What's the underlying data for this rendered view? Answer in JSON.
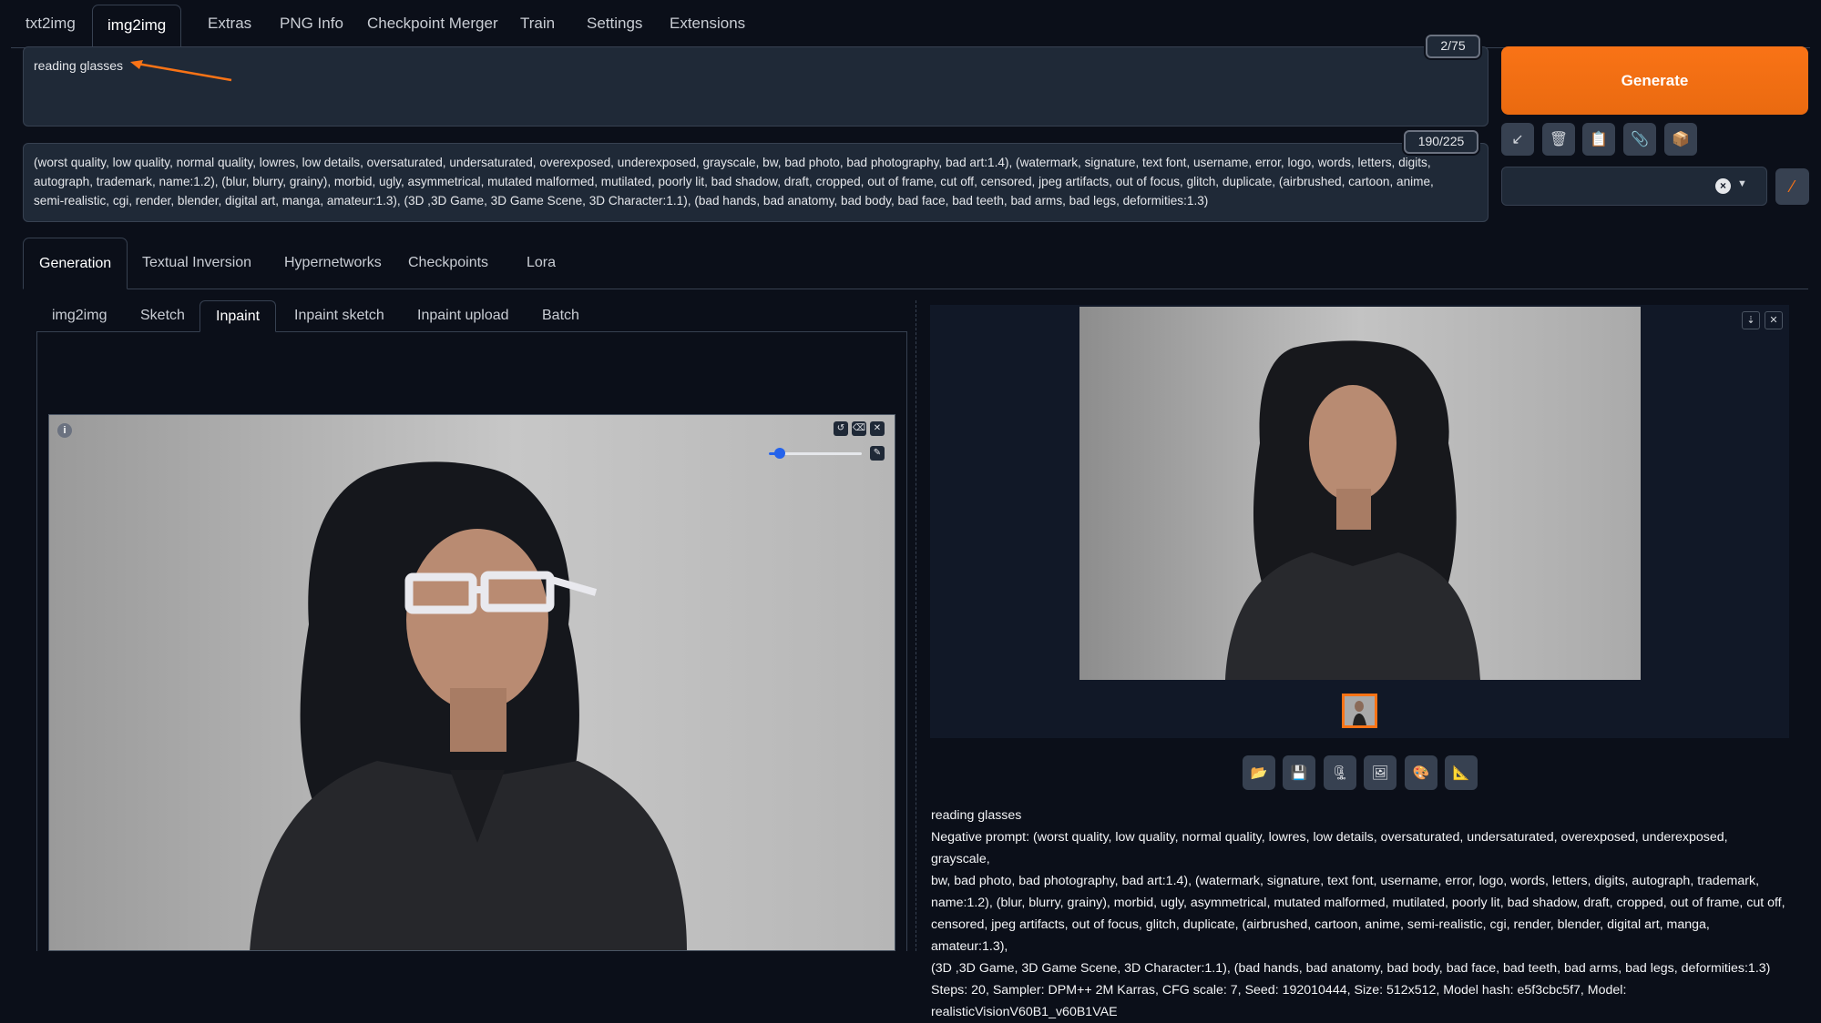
{
  "top_tabs": [
    "txt2img",
    "img2img",
    "Extras",
    "PNG Info",
    "Checkpoint Merger",
    "Train",
    "Settings",
    "Extensions"
  ],
  "prompt": {
    "value": "reading glasses",
    "token_count": "2/75"
  },
  "negative_prompt": {
    "token_count": "190/225",
    "lines": [
      "(worst quality, low quality, normal quality, lowres, low details, oversaturated, undersaturated, overexposed, underexposed, grayscale, bw, bad photo, bad photography, bad art:1.4), (watermark, signature, text font, username, error, logo, words, letters, digits,",
      "autograph, trademark, name:1.2), (blur, blurry, grainy), morbid, ugly, asymmetrical, mutated malformed, mutilated, poorly lit, bad shadow, draft, cropped, out of frame, cut off, censored, jpeg artifacts, out of focus, glitch, duplicate, (airbrushed, cartoon, anime,",
      "semi-realistic, cgi, render, blender, digital art, manga, amateur:1.3), (3D ,3D Game, 3D Game Scene, 3D Character:1.1), (bad hands, bad anatomy, bad body, bad face, bad teeth, bad arms, bad legs, deformities:1.3)"
    ]
  },
  "generate_label": "Generate",
  "tool_buttons": [
    {
      "icon": "arrow-down-left-icon",
      "glyph": "↙"
    },
    {
      "icon": "trash-icon",
      "glyph": "🗑"
    },
    {
      "icon": "clipboard-icon",
      "glyph": "📋"
    },
    {
      "icon": "paperclip-icon",
      "glyph": "📎"
    },
    {
      "icon": "package-icon",
      "glyph": "📦"
    }
  ],
  "section_tabs": [
    "Generation",
    "Textual Inversion",
    "Hypernetworks",
    "Checkpoints",
    "Lora"
  ],
  "mode_tabs": [
    "img2img",
    "Sketch",
    "Inpaint",
    "Inpaint sketch",
    "Inpaint upload",
    "Batch"
  ],
  "active_mode": "Inpaint",
  "brush_size_fraction": 0.12,
  "output_buttons": [
    {
      "icon": "folder-icon",
      "glyph": "📂"
    },
    {
      "icon": "save-icon",
      "glyph": "💾"
    },
    {
      "icon": "zip-icon",
      "glyph": "🗜"
    },
    {
      "icon": "image-icon",
      "glyph": "🖼"
    },
    {
      "icon": "palette-icon",
      "glyph": "🎨"
    },
    {
      "icon": "ruler-icon",
      "glyph": "📐"
    }
  ],
  "info": {
    "prompt": "reading glasses",
    "negative_lines": [
      "Negative prompt: (worst quality, low quality, normal quality, lowres, low details, oversaturated, undersaturated, overexposed, underexposed, grayscale,",
      "bw, bad photo, bad photography, bad art:1.4), (watermark, signature, text font, username, error, logo, words, letters, digits, autograph, trademark,",
      "name:1.2), (blur, blurry, grainy), morbid, ugly, asymmetrical, mutated malformed, mutilated, poorly lit, bad shadow, draft, cropped, out of frame, cut off,",
      "censored, jpeg artifacts, out of focus, glitch, duplicate, (airbrushed, cartoon, anime, semi-realistic, cgi, render, blender, digital art, manga, amateur:1.3),",
      "(3D ,3D Game, 3D Game Scene, 3D Character:1.1), (bad hands, bad anatomy, bad body, bad face, bad teeth, bad arms, bad legs, deformities:1.3)"
    ],
    "params": "Steps: 20, Sampler: DPM++ 2M Karras, CFG scale: 7, Seed: 192010444, Size: 512x512, Model hash: e5f3cbc5f7, Model: realisticVisionV60B1_v60B1VAE"
  },
  "colors": {
    "accent": "#f97316",
    "background": "#0b0f19",
    "panel": "#1f2937"
  }
}
